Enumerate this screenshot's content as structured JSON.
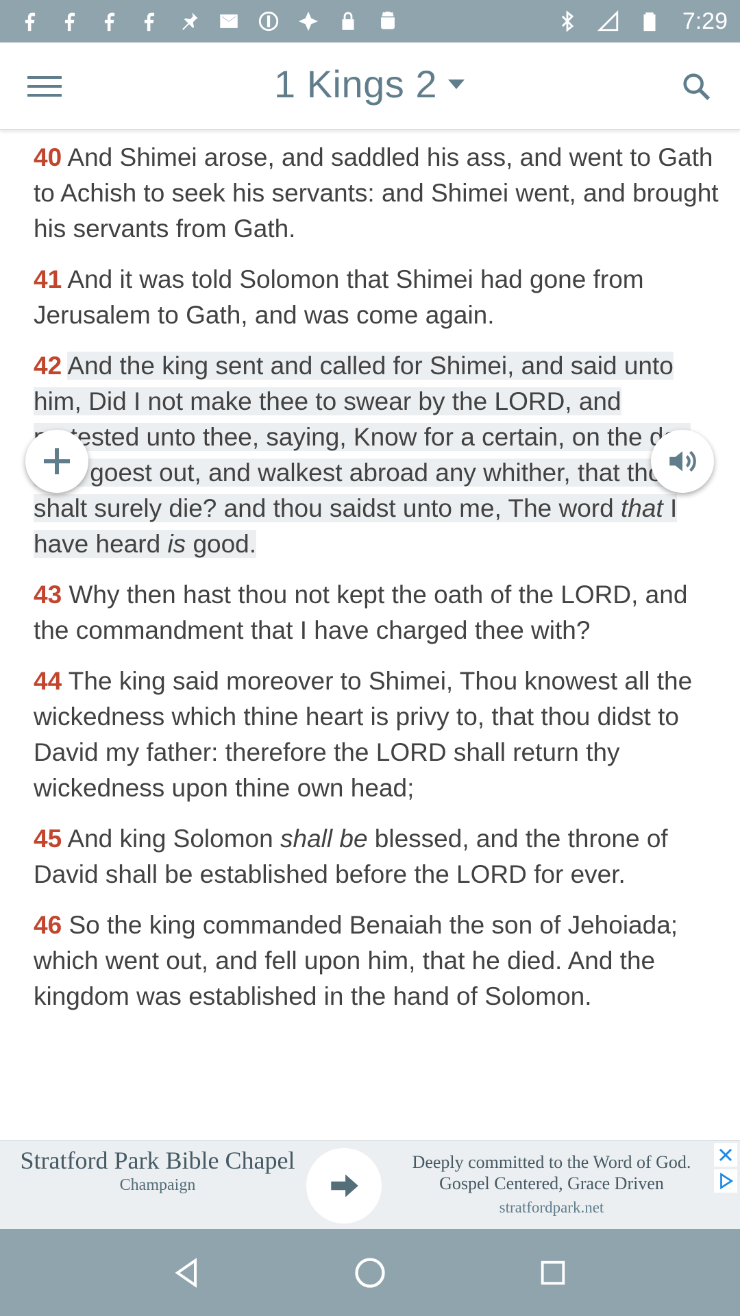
{
  "status_bar": {
    "time": "7:29",
    "icons": [
      "facebook-icon",
      "facebook-icon",
      "facebook-icon",
      "facebook-icon",
      "pin-icon",
      "mail-icon",
      "no-sim-icon",
      "fake-gps-icon",
      "lock-icon",
      "android-icon",
      "bluetooth-icon",
      "no-signal-icon",
      "battery-icon"
    ]
  },
  "header": {
    "title": "1 Kings 2",
    "menu_icon": "hamburger-menu-icon",
    "search_icon": "search-icon",
    "dropdown_icon": "dropdown-arrow-icon"
  },
  "verses": [
    {
      "num": "40",
      "text": "And Shimei arose, and saddled his ass, and went to Gath to Achish to seek his servants: and Shimei went, and brought his servants from Gath."
    },
    {
      "num": "41",
      "text": "And it was told Solomon that Shimei had gone from Jerusalem to Gath, and was come again."
    },
    {
      "num": "42",
      "text_a": "And the king sent and called for Shimei, and said unto him, Did I not make thee to swear by the LORD, and protested unto thee, saying, Know for a certain, on the day thou goest out, and walkest abroad any whither, that thou shalt surely die? and thou saidst unto me, The word ",
      "italic_1": "that",
      "text_b": " I have heard ",
      "italic_2": "is",
      "text_c": " good.",
      "highlighted": true
    },
    {
      "num": "43",
      "text": "Why then hast thou not kept the oath of the LORD, and the commandment that I have charged thee with?"
    },
    {
      "num": "44",
      "text": "The king said moreover to Shimei, Thou knowest all the wickedness which thine heart is privy to, that thou didst to David my father: therefore the LORD shall return thy wickedness upon thine own head;"
    },
    {
      "num": "45",
      "text_a": "And king Solomon ",
      "italic_1": "shall be",
      "text_b": " blessed, and the throne of David shall be established before the LORD for ever."
    },
    {
      "num": "46",
      "text": "So the king commanded Benaiah the son of Jehoiada; which went out, and fell upon him, that he died. And the kingdom was established in the hand of Solomon."
    }
  ],
  "fabs": {
    "add_icon": "plus-icon",
    "audio_icon": "speaker-icon"
  },
  "ad": {
    "title": "Stratford Park Bible Chapel",
    "subtitle": "Champaign",
    "tagline": "Deeply committed to the Word of God. Gospel Centered, Grace Driven",
    "url": "stratfordpark.net"
  },
  "nav_bar": {
    "back_icon": "back-triangle-icon",
    "home_icon": "home-circle-icon",
    "recents_icon": "recents-square-icon"
  },
  "colors": {
    "status_bar": "#90a4ae",
    "title": "#607d8b",
    "verse_number": "#c2452d",
    "highlight": "#eceff1"
  }
}
